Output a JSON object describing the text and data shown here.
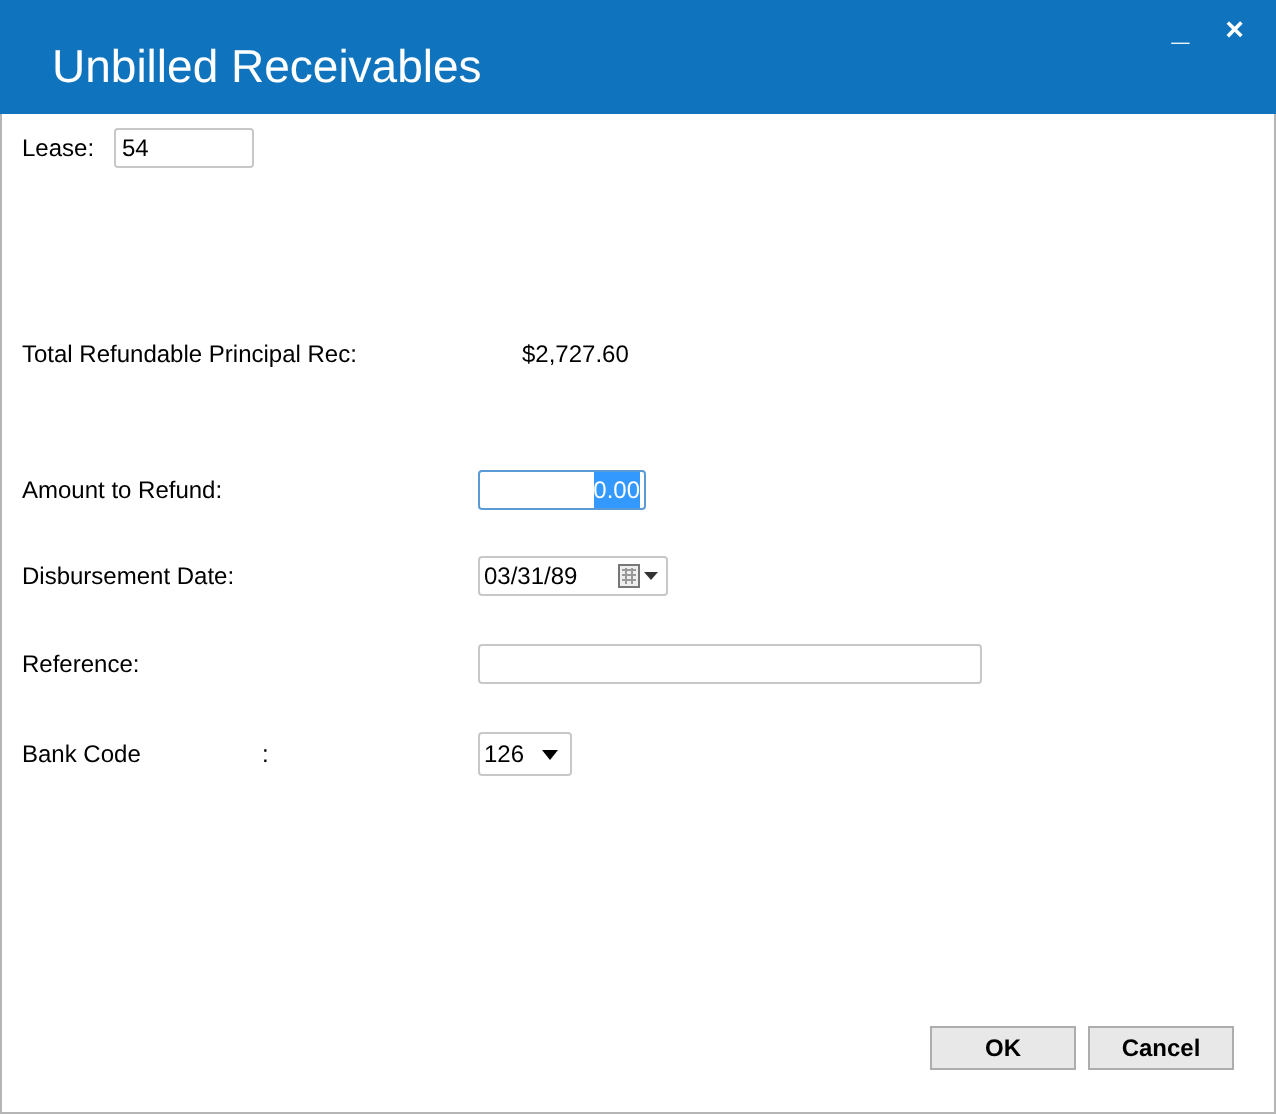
{
  "window": {
    "title": "Unbilled Receivables",
    "controls": [
      "_",
      "×"
    ]
  },
  "lease": {
    "label": "Lease:",
    "value": "54"
  },
  "total": {
    "label": "Total Refundable Principal Rec:",
    "value": "$2,727.60"
  },
  "amount": {
    "label": "Amount to Refund:",
    "value": "0.00",
    "text_selected": true
  },
  "date": {
    "label": "Disbursement Date:",
    "value": "03/31/89"
  },
  "reference": {
    "label": "Reference:"
  },
  "bank": {
    "label": "Bank Code",
    "colon": ":",
    "value": "126"
  },
  "buttons": [
    "OK",
    "Cancel"
  ]
}
